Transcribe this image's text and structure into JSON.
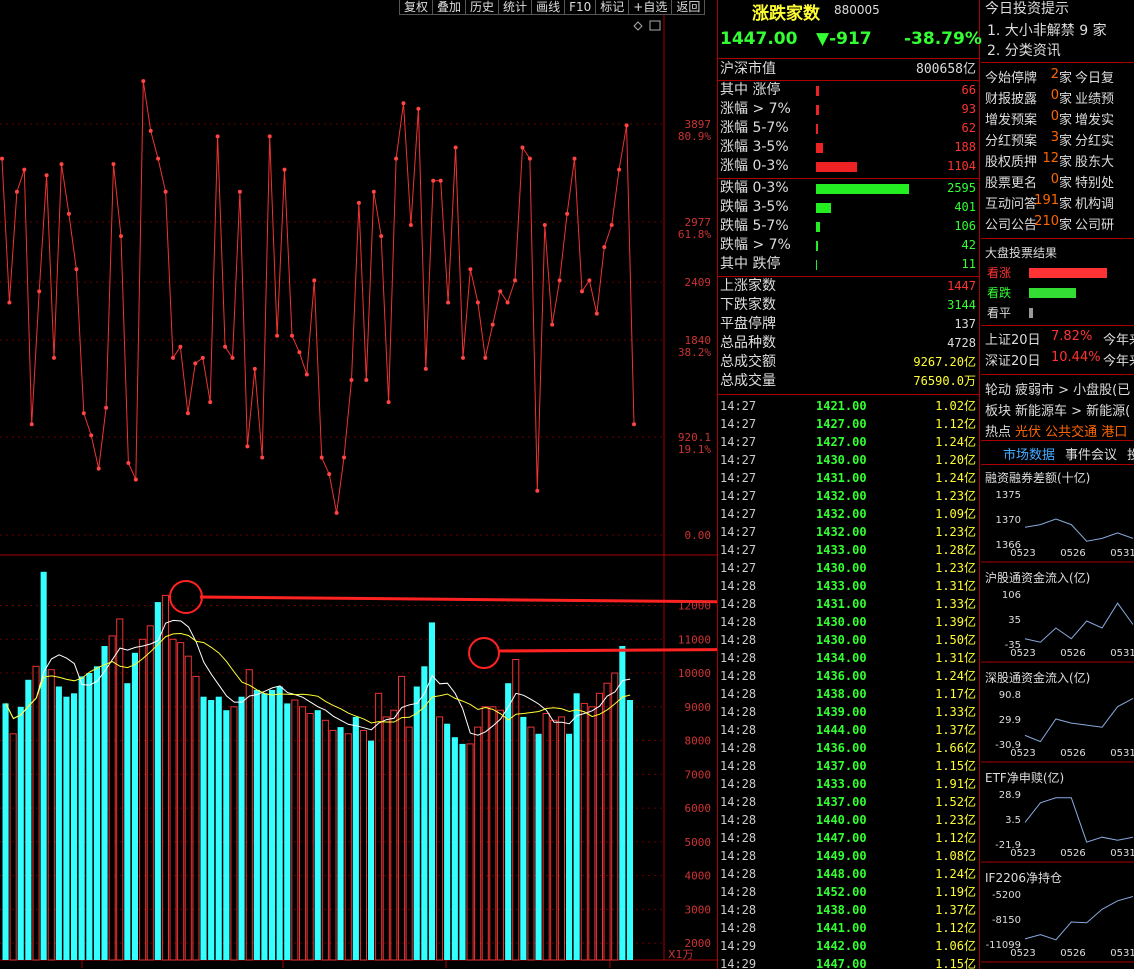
{
  "toolbar": [
    "复权",
    "叠加",
    "历史",
    "统计",
    "画线",
    "F10",
    "标记",
    "+自选",
    "返回"
  ],
  "header": {
    "title": "涨跌家数",
    "code": "880005",
    "price": "1447.00",
    "change": "▼-917",
    "pct": "-38.79%"
  },
  "market_cap": {
    "label": "沪深市值",
    "value": "800658亿"
  },
  "up_rows": [
    {
      "label": "其中 涨停",
      "value": "66",
      "frac": 0.02
    },
    {
      "label": "涨幅 > 7%",
      "value": "93",
      "frac": 0.02
    },
    {
      "label": "涨幅 5-7%",
      "value": "62",
      "frac": 0.015
    },
    {
      "label": "涨幅 3-5%",
      "value": "188",
      "frac": 0.045
    },
    {
      "label": "涨幅 0-3%",
      "value": "1104",
      "frac": 0.27
    }
  ],
  "down_rows": [
    {
      "label": "跌幅 0-3%",
      "value": "2595",
      "frac": 0.62
    },
    {
      "label": "跌幅 3-5%",
      "value": "401",
      "frac": 0.1
    },
    {
      "label": "跌幅 5-7%",
      "value": "106",
      "frac": 0.025
    },
    {
      "label": "跌幅 > 7%",
      "value": "42",
      "frac": 0.01
    },
    {
      "label": "其中 跌停",
      "value": "11",
      "frac": 0.005
    }
  ],
  "stats_rows": [
    {
      "label": "上涨家数",
      "value": "1447",
      "color": "#ff3333"
    },
    {
      "label": "下跌家数",
      "value": "3144",
      "color": "#33ff33"
    },
    {
      "label": "平盘停牌",
      "value": "137",
      "color": "#dddddd"
    },
    {
      "label": "总品种数",
      "value": "4728",
      "color": "#dddddd"
    },
    {
      "label": "总成交额",
      "value": "9267.20亿",
      "color": "#ffff33"
    },
    {
      "label": "总成交量",
      "value": "76590.0万",
      "color": "#ffff33"
    }
  ],
  "ticks": [
    {
      "t": "14:27",
      "p": "1421.00",
      "v": "1.02亿"
    },
    {
      "t": "14:27",
      "p": "1427.00",
      "v": "1.12亿"
    },
    {
      "t": "14:27",
      "p": "1427.00",
      "v": "1.24亿"
    },
    {
      "t": "14:27",
      "p": "1430.00",
      "v": "1.20亿"
    },
    {
      "t": "14:27",
      "p": "1431.00",
      "v": "1.24亿"
    },
    {
      "t": "14:27",
      "p": "1432.00",
      "v": "1.23亿"
    },
    {
      "t": "14:27",
      "p": "1432.00",
      "v": "1.09亿"
    },
    {
      "t": "14:27",
      "p": "1432.00",
      "v": "1.23亿"
    },
    {
      "t": "14:27",
      "p": "1433.00",
      "v": "1.28亿"
    },
    {
      "t": "14:27",
      "p": "1430.00",
      "v": "1.23亿"
    },
    {
      "t": "14:28",
      "p": "1433.00",
      "v": "1.31亿"
    },
    {
      "t": "14:28",
      "p": "1431.00",
      "v": "1.33亿"
    },
    {
      "t": "14:28",
      "p": "1430.00",
      "v": "1.39亿"
    },
    {
      "t": "14:28",
      "p": "1430.00",
      "v": "1.50亿"
    },
    {
      "t": "14:28",
      "p": "1434.00",
      "v": "1.31亿"
    },
    {
      "t": "14:28",
      "p": "1436.00",
      "v": "1.24亿"
    },
    {
      "t": "14:28",
      "p": "1438.00",
      "v": "1.17亿"
    },
    {
      "t": "14:28",
      "p": "1439.00",
      "v": "1.33亿"
    },
    {
      "t": "14:28",
      "p": "1444.00",
      "v": "1.37亿"
    },
    {
      "t": "14:28",
      "p": "1436.00",
      "v": "1.66亿"
    },
    {
      "t": "14:28",
      "p": "1437.00",
      "v": "1.15亿"
    },
    {
      "t": "14:28",
      "p": "1433.00",
      "v": "1.91亿"
    },
    {
      "t": "14:28",
      "p": "1437.00",
      "v": "1.52亿"
    },
    {
      "t": "14:28",
      "p": "1440.00",
      "v": "1.23亿"
    },
    {
      "t": "14:28",
      "p": "1447.00",
      "v": "1.12亿"
    },
    {
      "t": "14:28",
      "p": "1449.00",
      "v": "1.08亿"
    },
    {
      "t": "14:28",
      "p": "1448.00",
      "v": "1.24亿"
    },
    {
      "t": "14:28",
      "p": "1452.00",
      "v": "1.19亿"
    },
    {
      "t": "14:28",
      "p": "1438.00",
      "v": "1.37亿"
    },
    {
      "t": "14:28",
      "p": "1441.00",
      "v": "1.12亿"
    },
    {
      "t": "14:29",
      "p": "1442.00",
      "v": "1.06亿"
    },
    {
      "t": "14:29",
      "p": "1447.00",
      "v": "1.15亿"
    }
  ],
  "tips": {
    "title": "今日投资提示",
    "items": [
      "1. 大小非解禁 9 家",
      "2. 分类资讯"
    ]
  },
  "events": [
    {
      "a": "今始停牌",
      "n": "2",
      "b": "今日复"
    },
    {
      "a": "财报披露",
      "n": "0",
      "b": "业绩预"
    },
    {
      "a": "增发预案",
      "n": "0",
      "b": "增发实"
    },
    {
      "a": "分红预案",
      "n": "3",
      "b": "分红实"
    },
    {
      "a": "股权质押",
      "n": "12",
      "b": "股东大"
    },
    {
      "a": "股票更名",
      "n": "0",
      "b": "特别处"
    },
    {
      "a": "互动问答",
      "n": "191",
      "b": "机构调"
    },
    {
      "a": "公司公告",
      "n": "210",
      "b": "公司研"
    }
  ],
  "vote": {
    "title": "大盘投票结果",
    "rows": [
      {
        "label": "看涨",
        "color": "#ff3333",
        "frac": 0.7
      },
      {
        "label": "看跌",
        "color": "#33dd33",
        "frac": 0.42
      },
      {
        "label": "看平",
        "color": "#999999",
        "frac": 0.04
      }
    ]
  },
  "index20": [
    {
      "label": "上证20日",
      "value": "7.82%",
      "extra": "今年来"
    },
    {
      "label": "深证20日",
      "value": "10.44%",
      "extra": "今年来"
    }
  ],
  "themes": [
    {
      "label": "轮动",
      "text": "疲弱市 > 小盘股(已"
    },
    {
      "label": "板块",
      "text": "新能源车 > 新能源("
    },
    {
      "label": "热点",
      "text": "光伏  公共交通  港口"
    }
  ],
  "tabs": [
    "市场数据",
    "事件会议",
    "投"
  ],
  "minicharts": [
    {
      "title": "融资融券差额(十亿)",
      "y": [
        "1375",
        "1370",
        "1366"
      ],
      "x": [
        "0523",
        "0526",
        "0531"
      ],
      "values": [
        1369,
        1369.5,
        1370.5,
        1369.5,
        1366.5,
        1367,
        1368,
        1367
      ]
    },
    {
      "title": "沪股通资金流入(亿)",
      "y": [
        "106",
        "35",
        "-35"
      ],
      "x": [
        "0523",
        "0526",
        "0531"
      ],
      "values": [
        -20,
        -30,
        10,
        -20,
        30,
        10,
        80,
        20
      ]
    },
    {
      "title": "深股通资金流入(亿)",
      "y": [
        "90.8",
        "29.9",
        "-30.9"
      ],
      "x": [
        "0523",
        "0526",
        "0531"
      ],
      "values": [
        -10,
        -25,
        30,
        20,
        15,
        10,
        60,
        80
      ]
    },
    {
      "title": "ETF净申赎(亿)",
      "y": [
        "28.9",
        "3.5",
        "-21.9"
      ],
      "x": [
        "0523",
        "0526",
        "0531"
      ],
      "values": [
        0,
        20,
        25,
        25,
        -20,
        -15,
        -18,
        -15
      ]
    },
    {
      "title": "IF2206净持仓",
      "y": [
        "-5200",
        "-8150",
        "-11099"
      ],
      "x": [
        "0523",
        "0526",
        "0531"
      ],
      "values": [
        -10500,
        -10000,
        -10600,
        -8500,
        -8600,
        -7000,
        -6000,
        -5500
      ]
    }
  ],
  "chart_data": {
    "type": "line",
    "main": {
      "ytick_labels": [
        "3897",
        "2977",
        "2409",
        "1840",
        "920.1",
        "0.00"
      ],
      "ypct_labels": [
        "80.9%",
        "61.8%",
        "38.2%",
        "19.1%"
      ],
      "values": [
        3400,
        2100,
        3100,
        3300,
        1000,
        2200,
        3250,
        1600,
        3350,
        2900,
        2400,
        1100,
        900,
        600,
        1150,
        3350,
        2700,
        650,
        500,
        4100,
        3650,
        3400,
        3100,
        1600,
        1700,
        1100,
        1550,
        1600,
        1200,
        3600,
        1700,
        1600,
        3100,
        800,
        1500,
        700,
        3600,
        1800,
        3300,
        1800,
        1650,
        1450,
        2300,
        700,
        550,
        200,
        700,
        1400,
        3000,
        1400,
        3100,
        2700,
        1200,
        3400,
        3900,
        2800,
        3850,
        1500,
        3200,
        3200,
        2100,
        3500,
        1600,
        2400,
        2100,
        1600,
        1900,
        2200,
        2100,
        2300,
        3500,
        3400,
        400,
        2800,
        1900,
        2300,
        2900,
        3400,
        2200,
        2300,
        2000,
        2600,
        2800,
        3300,
        3700,
        1000
      ],
      "ymax": 4200
    },
    "volume": {
      "ytick_labels": [
        "12000",
        "11000",
        "10000",
        "9000",
        "8000",
        "7000",
        "6000",
        "5000",
        "4000",
        "3000",
        "2000"
      ],
      "unit": "X1万",
      "ymin": 1500,
      "ymax": 13200
    }
  }
}
